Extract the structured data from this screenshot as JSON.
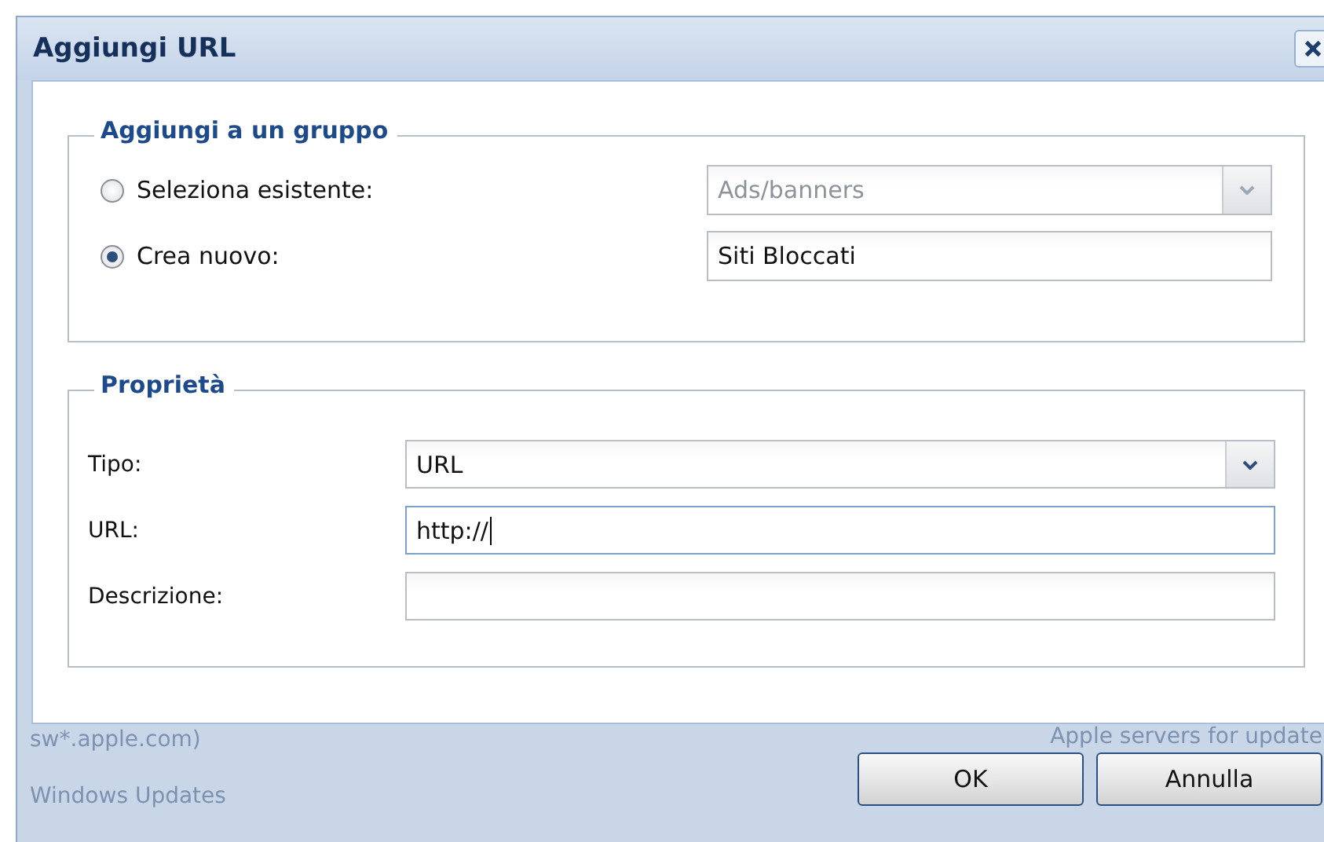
{
  "window": {
    "title": "Aggiungi URL"
  },
  "group": {
    "legend": "Aggiungi a un gruppo",
    "options": [
      {
        "label": "Seleziona esistente:",
        "selected": false,
        "kind": "dropdown",
        "value": "Ads/banners",
        "disabled": true
      },
      {
        "label": "Crea nuovo:",
        "selected": true,
        "kind": "text",
        "value": "Siti Bloccati",
        "disabled": false
      }
    ]
  },
  "properties": {
    "legend": "Proprietà",
    "fields": [
      {
        "label": "Tipo:",
        "kind": "dropdown",
        "value": "URL",
        "focused": false
      },
      {
        "label": "URL:",
        "kind": "text",
        "value": "http://",
        "focused": true
      },
      {
        "label": "Descrizione:",
        "kind": "text",
        "focused": false
      }
    ]
  },
  "background_text": {
    "left": [
      "sw*.apple.com)",
      "Windows Updates"
    ],
    "right": "Apple servers for update"
  },
  "buttons": [
    "OK",
    "Annulla"
  ]
}
